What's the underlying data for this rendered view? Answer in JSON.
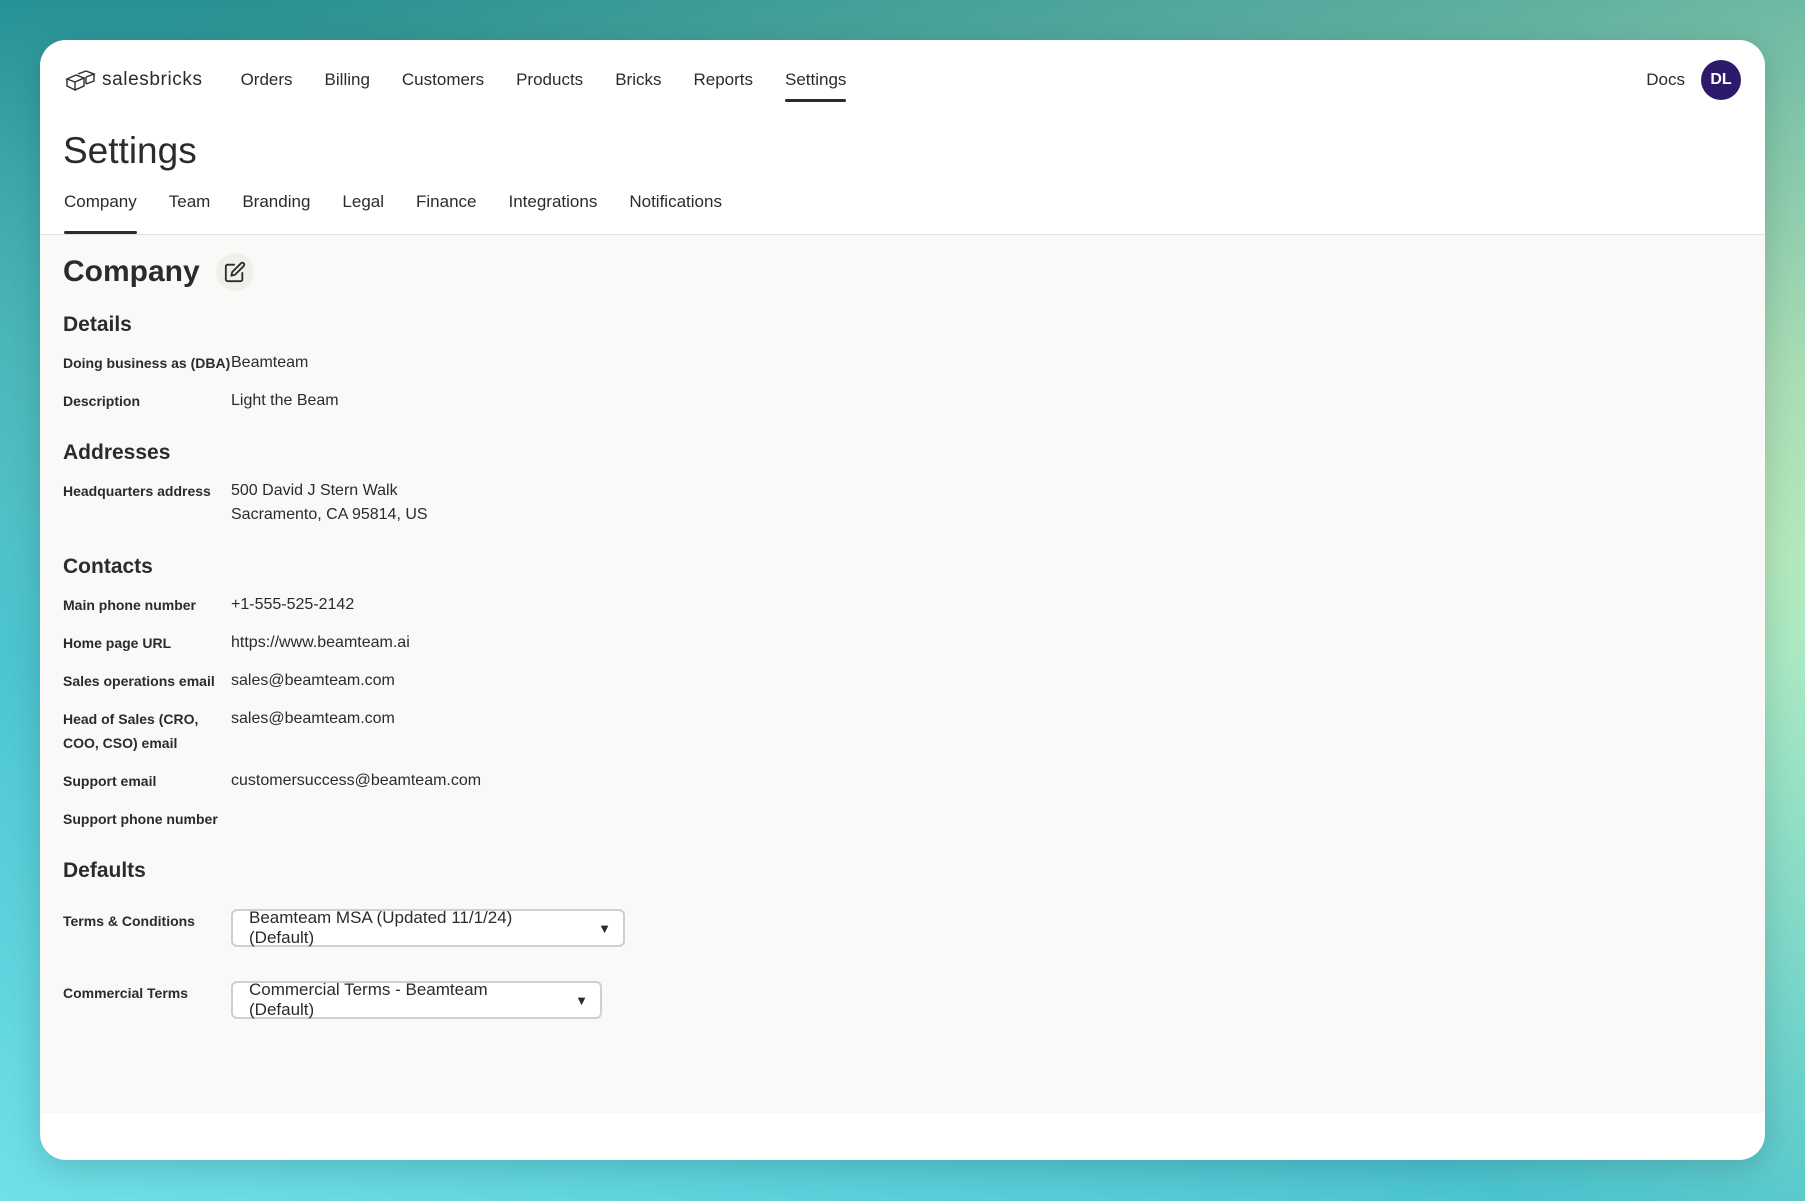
{
  "app": {
    "logo_text": "salesbricks"
  },
  "nav": {
    "items": [
      "Orders",
      "Billing",
      "Customers",
      "Products",
      "Bricks",
      "Reports",
      "Settings"
    ],
    "active": "Settings",
    "docs": "Docs",
    "avatar_initials": "DL"
  },
  "page": {
    "title": "Settings"
  },
  "tabs": {
    "items": [
      "Company",
      "Team",
      "Branding",
      "Legal",
      "Finance",
      "Integrations",
      "Notifications"
    ],
    "active": "Company"
  },
  "company": {
    "title": "Company",
    "details": {
      "title": "Details",
      "dba_label": "Doing business as (DBA)",
      "dba_value": "Beamteam",
      "description_label": "Description",
      "description_value": "Light the Beam"
    },
    "addresses": {
      "title": "Addresses",
      "hq_label": "Headquarters address",
      "hq_line1": "500 David J Stern Walk",
      "hq_line2": "Sacramento, CA 95814, US"
    },
    "contacts": {
      "title": "Contacts",
      "main_phone_label": "Main phone number",
      "main_phone_value": "+1-555-525-2142",
      "homepage_label": "Home page URL",
      "homepage_value": "https://www.beamteam.ai",
      "sales_ops_label": "Sales operations email",
      "sales_ops_value": "sales@beamteam.com",
      "head_sales_label": "Head of Sales (CRO, COO, CSO) email",
      "head_sales_value": "sales@beamteam.com",
      "support_email_label": "Support email",
      "support_email_value": "customersuccess@beamteam.com",
      "support_phone_label": "Support phone number",
      "support_phone_value": ""
    },
    "defaults": {
      "title": "Defaults",
      "terms_label": "Terms & Conditions",
      "terms_value": "Beamteam MSA (Updated 11/1/24) (Default)",
      "commercial_label": "Commercial Terms",
      "commercial_value": "Commercial Terms - Beamteam (Default)"
    }
  },
  "colors": {
    "accent": "#2e1a6b",
    "text": "#2b2b2b",
    "content_bg": "#faf9f7"
  }
}
